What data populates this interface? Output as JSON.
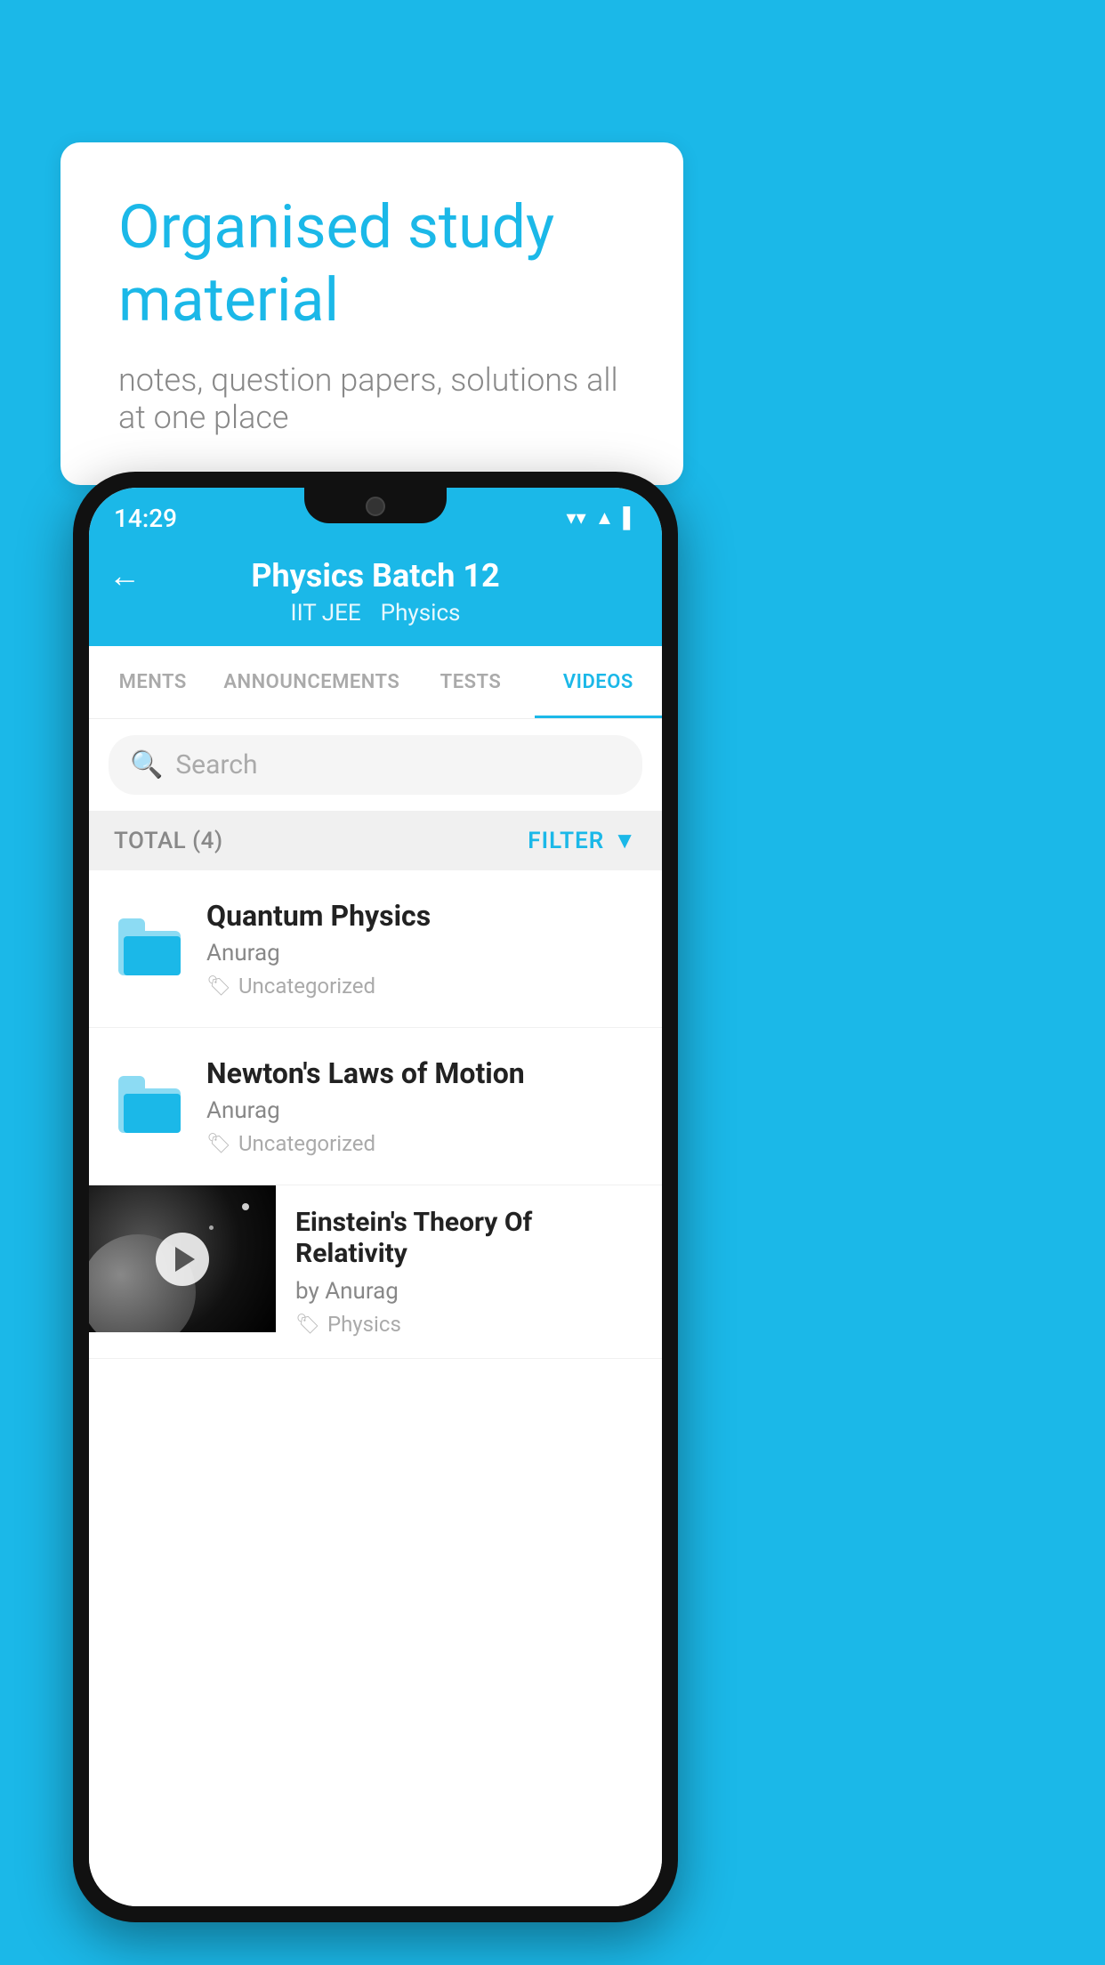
{
  "background_color": "#1BB8E8",
  "speech_bubble": {
    "heading": "Organised study material",
    "subtext": "notes, question papers, solutions all at one place"
  },
  "phone": {
    "status_bar": {
      "time": "14:29",
      "wifi": "▲",
      "signal": "◀",
      "battery": "▌"
    },
    "header": {
      "title": "Physics Batch 12",
      "subtitle1": "IIT JEE",
      "subtitle2": "Physics",
      "back_label": "←"
    },
    "tabs": [
      {
        "label": "MENTS",
        "active": false
      },
      {
        "label": "ANNOUNCEMENTS",
        "active": false
      },
      {
        "label": "TESTS",
        "active": false
      },
      {
        "label": "VIDEOS",
        "active": true
      }
    ],
    "search": {
      "placeholder": "Search"
    },
    "filter_bar": {
      "total_label": "TOTAL (4)",
      "filter_label": "FILTER"
    },
    "list_items": [
      {
        "id": 0,
        "type": "folder",
        "title": "Quantum Physics",
        "author": "Anurag",
        "tag": "Uncategorized"
      },
      {
        "id": 1,
        "type": "folder",
        "title": "Newton's Laws of Motion",
        "author": "Anurag",
        "tag": "Uncategorized"
      },
      {
        "id": 2,
        "type": "video",
        "title": "Einstein's Theory Of Relativity",
        "author": "by Anurag",
        "tag": "Physics"
      }
    ]
  }
}
